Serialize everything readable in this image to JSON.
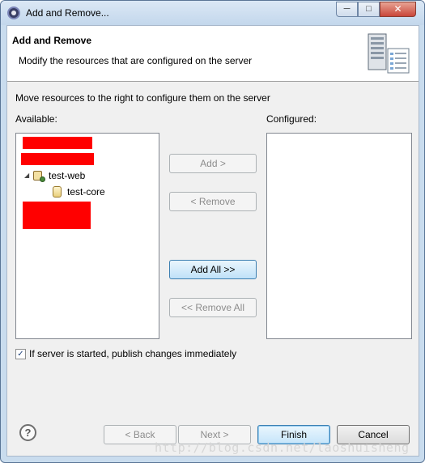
{
  "window": {
    "title": "Add and Remove...",
    "controls": {
      "minimize": "─",
      "maximize": "□",
      "close": "✕"
    }
  },
  "banner": {
    "title": "Add and Remove",
    "description": "Modify the resources that are configured on the server",
    "icon": "server-icon"
  },
  "intro_text": "Move resources to the right to configure them on the server",
  "available": {
    "label": "Available:",
    "items": [
      {
        "label": "test-web",
        "icon": "web-project-icon",
        "expanded": true,
        "toggle": "◢"
      },
      {
        "label": "test-core",
        "icon": "jar-icon"
      }
    ]
  },
  "configured": {
    "label": "Configured:",
    "items": []
  },
  "buttons": {
    "add": "Add >",
    "remove": "< Remove",
    "add_all": "Add All >>",
    "remove_all": "<< Remove All"
  },
  "publish_checkbox": {
    "label": "If server is started, publish changes immediately",
    "checked": true,
    "mark": "✓"
  },
  "footer": {
    "help": "?",
    "back": "< Back",
    "next": "Next >",
    "finish": "Finish",
    "cancel": "Cancel"
  },
  "watermark": "http://blog.csdn.net/laoshuisheng",
  "colors": {
    "redaction": "#ff0000",
    "accent": "#3c7fb1"
  }
}
